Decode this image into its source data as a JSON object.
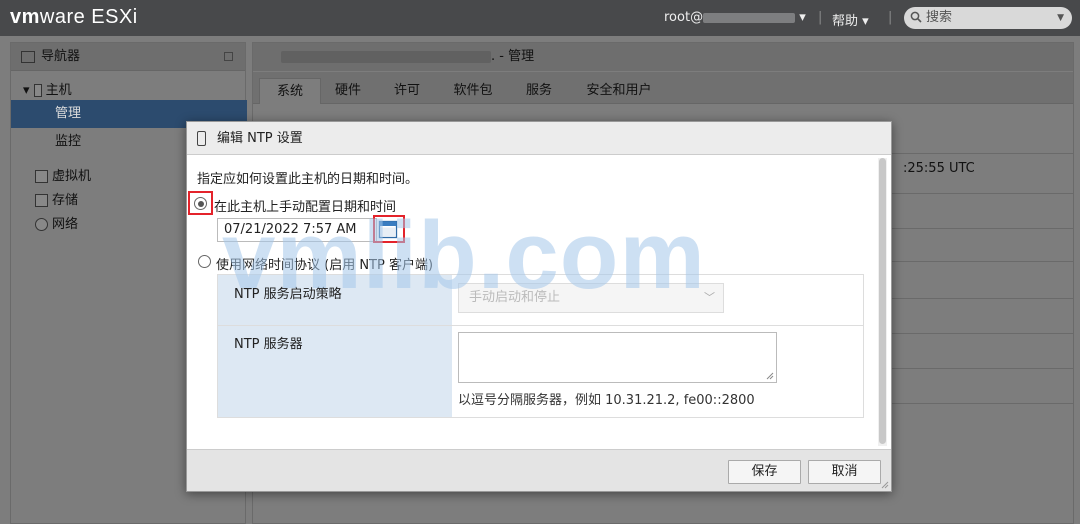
{
  "topbar": {
    "logo_vm": "vm",
    "logo_ware": "ware",
    "logo_product": "ESXi",
    "user": "root@",
    "help": "帮助 ▾",
    "search_placeholder": "搜索"
  },
  "navigator": {
    "title": "导航器",
    "items": [
      {
        "label": "主机"
      },
      {
        "label": "管理"
      },
      {
        "label": "监控"
      },
      {
        "label": "虚拟机"
      },
      {
        "label": "存储"
      },
      {
        "label": "网络"
      }
    ]
  },
  "main": {
    "title_suffix": ". - 管理",
    "tabs": [
      "系统",
      "硬件",
      "许可",
      "软件包",
      "服务",
      "安全和用户"
    ],
    "bg_time": ":25:55 UTC"
  },
  "dialog": {
    "title": "编辑 NTP 设置",
    "description": "指定应如何设置此主机的日期和时间。",
    "option_manual": "在此主机上手动配置日期和时间",
    "date_value": "07/21/2022 7:57 AM",
    "option_ntp": "使用网络时间协议 (启用 NTP 客户端)",
    "ntp_policy_label": "NTP 服务启动策略",
    "ntp_policy_value": "手动启动和停止",
    "ntp_server_label": "NTP 服务器",
    "ntp_server_value": "",
    "ntp_server_hint": "以逗号分隔服务器，例如 10.31.21.2, fe00::2800",
    "save": "保存",
    "cancel": "取消"
  },
  "watermark": "vmlib.com",
  "colors": {
    "highlight_red": "#e4232b",
    "nav_selected": "#2c4b6e",
    "watermark": "#a4c7ea"
  }
}
